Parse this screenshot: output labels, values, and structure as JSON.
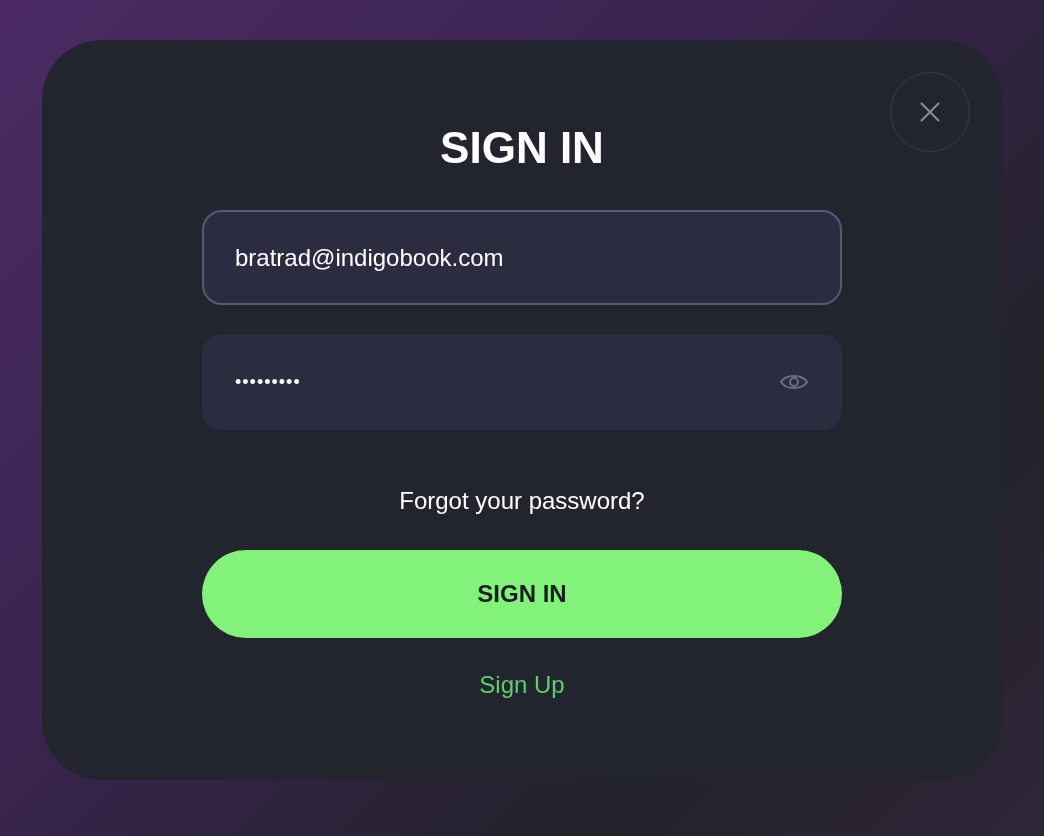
{
  "dialog": {
    "title": "SIGN IN",
    "fields": [
      {
        "kind": "text",
        "value": "bratrad@indigobook.com",
        "focused": true
      },
      {
        "kind": "password",
        "value": "•••••••••",
        "focused": false
      }
    ],
    "forgot_link": "Forgot your password?",
    "submit_button": "SIGN IN",
    "signup_link": "Sign Up"
  }
}
